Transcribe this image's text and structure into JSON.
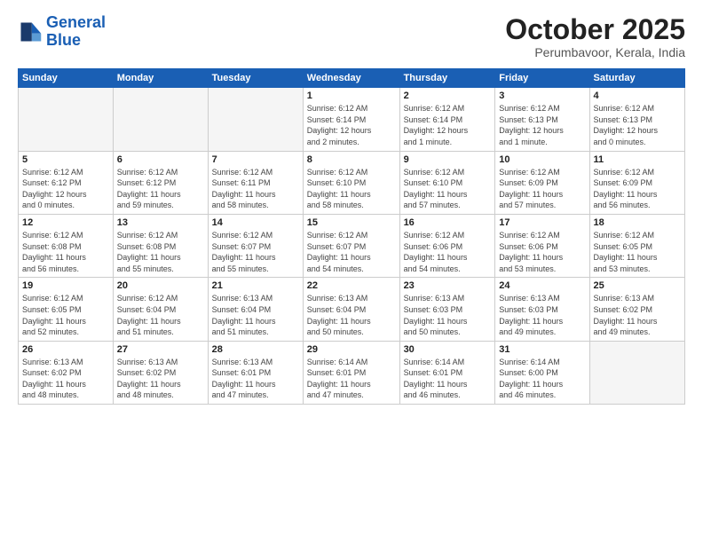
{
  "logo": {
    "line1": "General",
    "line2": "Blue"
  },
  "title": "October 2025",
  "location": "Perumbavoor, Kerala, India",
  "weekdays": [
    "Sunday",
    "Monday",
    "Tuesday",
    "Wednesday",
    "Thursday",
    "Friday",
    "Saturday"
  ],
  "weeks": [
    [
      {
        "day": "",
        "info": ""
      },
      {
        "day": "",
        "info": ""
      },
      {
        "day": "",
        "info": ""
      },
      {
        "day": "1",
        "info": "Sunrise: 6:12 AM\nSunset: 6:14 PM\nDaylight: 12 hours\nand 2 minutes."
      },
      {
        "day": "2",
        "info": "Sunrise: 6:12 AM\nSunset: 6:14 PM\nDaylight: 12 hours\nand 1 minute."
      },
      {
        "day": "3",
        "info": "Sunrise: 6:12 AM\nSunset: 6:13 PM\nDaylight: 12 hours\nand 1 minute."
      },
      {
        "day": "4",
        "info": "Sunrise: 6:12 AM\nSunset: 6:13 PM\nDaylight: 12 hours\nand 0 minutes."
      }
    ],
    [
      {
        "day": "5",
        "info": "Sunrise: 6:12 AM\nSunset: 6:12 PM\nDaylight: 12 hours\nand 0 minutes."
      },
      {
        "day": "6",
        "info": "Sunrise: 6:12 AM\nSunset: 6:12 PM\nDaylight: 11 hours\nand 59 minutes."
      },
      {
        "day": "7",
        "info": "Sunrise: 6:12 AM\nSunset: 6:11 PM\nDaylight: 11 hours\nand 58 minutes."
      },
      {
        "day": "8",
        "info": "Sunrise: 6:12 AM\nSunset: 6:10 PM\nDaylight: 11 hours\nand 58 minutes."
      },
      {
        "day": "9",
        "info": "Sunrise: 6:12 AM\nSunset: 6:10 PM\nDaylight: 11 hours\nand 57 minutes."
      },
      {
        "day": "10",
        "info": "Sunrise: 6:12 AM\nSunset: 6:09 PM\nDaylight: 11 hours\nand 57 minutes."
      },
      {
        "day": "11",
        "info": "Sunrise: 6:12 AM\nSunset: 6:09 PM\nDaylight: 11 hours\nand 56 minutes."
      }
    ],
    [
      {
        "day": "12",
        "info": "Sunrise: 6:12 AM\nSunset: 6:08 PM\nDaylight: 11 hours\nand 56 minutes."
      },
      {
        "day": "13",
        "info": "Sunrise: 6:12 AM\nSunset: 6:08 PM\nDaylight: 11 hours\nand 55 minutes."
      },
      {
        "day": "14",
        "info": "Sunrise: 6:12 AM\nSunset: 6:07 PM\nDaylight: 11 hours\nand 55 minutes."
      },
      {
        "day": "15",
        "info": "Sunrise: 6:12 AM\nSunset: 6:07 PM\nDaylight: 11 hours\nand 54 minutes."
      },
      {
        "day": "16",
        "info": "Sunrise: 6:12 AM\nSunset: 6:06 PM\nDaylight: 11 hours\nand 54 minutes."
      },
      {
        "day": "17",
        "info": "Sunrise: 6:12 AM\nSunset: 6:06 PM\nDaylight: 11 hours\nand 53 minutes."
      },
      {
        "day": "18",
        "info": "Sunrise: 6:12 AM\nSunset: 6:05 PM\nDaylight: 11 hours\nand 53 minutes."
      }
    ],
    [
      {
        "day": "19",
        "info": "Sunrise: 6:12 AM\nSunset: 6:05 PM\nDaylight: 11 hours\nand 52 minutes."
      },
      {
        "day": "20",
        "info": "Sunrise: 6:12 AM\nSunset: 6:04 PM\nDaylight: 11 hours\nand 51 minutes."
      },
      {
        "day": "21",
        "info": "Sunrise: 6:13 AM\nSunset: 6:04 PM\nDaylight: 11 hours\nand 51 minutes."
      },
      {
        "day": "22",
        "info": "Sunrise: 6:13 AM\nSunset: 6:04 PM\nDaylight: 11 hours\nand 50 minutes."
      },
      {
        "day": "23",
        "info": "Sunrise: 6:13 AM\nSunset: 6:03 PM\nDaylight: 11 hours\nand 50 minutes."
      },
      {
        "day": "24",
        "info": "Sunrise: 6:13 AM\nSunset: 6:03 PM\nDaylight: 11 hours\nand 49 minutes."
      },
      {
        "day": "25",
        "info": "Sunrise: 6:13 AM\nSunset: 6:02 PM\nDaylight: 11 hours\nand 49 minutes."
      }
    ],
    [
      {
        "day": "26",
        "info": "Sunrise: 6:13 AM\nSunset: 6:02 PM\nDaylight: 11 hours\nand 48 minutes."
      },
      {
        "day": "27",
        "info": "Sunrise: 6:13 AM\nSunset: 6:02 PM\nDaylight: 11 hours\nand 48 minutes."
      },
      {
        "day": "28",
        "info": "Sunrise: 6:13 AM\nSunset: 6:01 PM\nDaylight: 11 hours\nand 47 minutes."
      },
      {
        "day": "29",
        "info": "Sunrise: 6:14 AM\nSunset: 6:01 PM\nDaylight: 11 hours\nand 47 minutes."
      },
      {
        "day": "30",
        "info": "Sunrise: 6:14 AM\nSunset: 6:01 PM\nDaylight: 11 hours\nand 46 minutes."
      },
      {
        "day": "31",
        "info": "Sunrise: 6:14 AM\nSunset: 6:00 PM\nDaylight: 11 hours\nand 46 minutes."
      },
      {
        "day": "",
        "info": ""
      }
    ]
  ]
}
